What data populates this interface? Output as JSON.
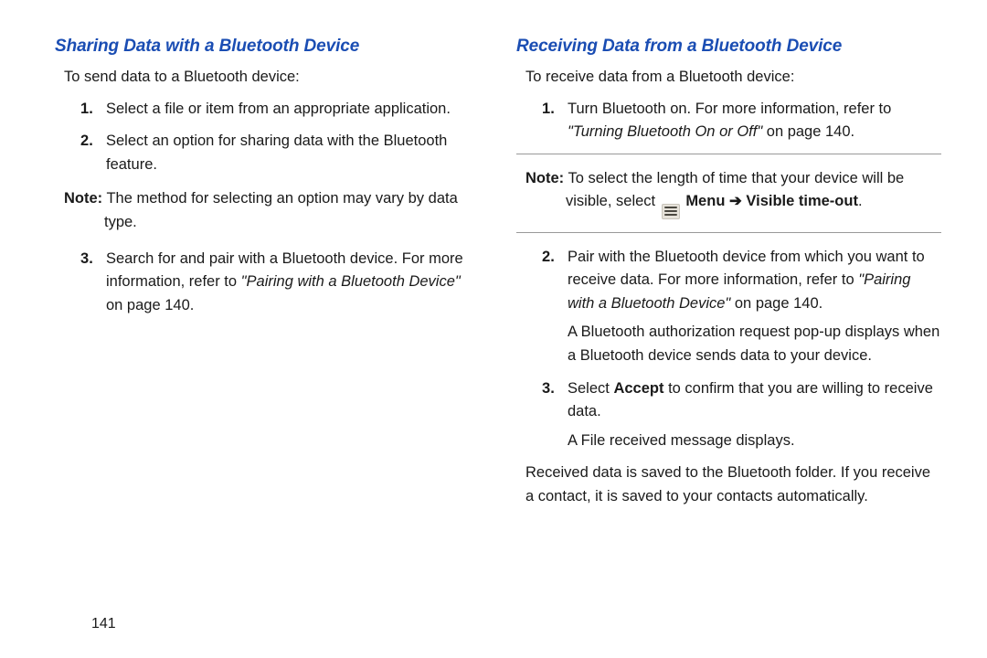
{
  "left": {
    "heading": "Sharing Data with a Bluetooth Device",
    "intro": "To send data to a Bluetooth device:",
    "step1": "Select a file or item from an appropriate application.",
    "step2": "Select an option for sharing data with the Bluetooth feature.",
    "note_label": "Note:",
    "note_text": " The method for selecting an option may vary by data type.",
    "step3_a": "Search for and pair with a Bluetooth device. For more information, refer to ",
    "step3_ref": "\"Pairing with a Bluetooth Device\"",
    "step3_b": " on page 140."
  },
  "right": {
    "heading": "Receiving Data from a Bluetooth Device",
    "intro": "To receive data from a Bluetooth device:",
    "step1_a": "Turn Bluetooth on. For more information, refer to ",
    "step1_ref": "\"Turning Bluetooth On or Off\"",
    "step1_b": " on page 140.",
    "note_label": "Note:",
    "note_a": " To select the length of time that your device will be visible, select ",
    "note_menu": "Menu",
    "note_arrow": " ➔ ",
    "note_visible": "Visible time-out",
    "note_period": ".",
    "step2_a": "Pair with the Bluetooth device from which you want to receive data. For more information, refer to ",
    "step2_ref": "\"Pairing with a Bluetooth Device\"",
    "step2_b": " on page 140.",
    "step2_sub": "A Bluetooth authorization request pop-up displays when a Bluetooth device sends data to your device.",
    "step3_a": "Select ",
    "step3_accept": "Accept",
    "step3_b": " to confirm that you are willing to receive data.",
    "step3_sub": "A File received message displays.",
    "trail": "Received data is saved to the Bluetooth folder. If you receive a contact, it is saved to your contacts automatically."
  },
  "pagenum": "141"
}
